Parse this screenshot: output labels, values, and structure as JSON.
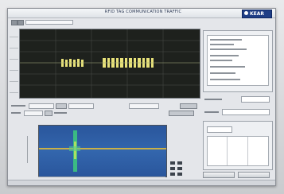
{
  "window": {
    "title": "RFID TAG COMMUNICATION TRAFFIC",
    "brand": "KEAR"
  },
  "toolbar": {
    "selector_value": ""
  },
  "colors": {
    "plot_background": "#1e211d",
    "signal_pulse": "#e8e27a",
    "spectrogram_background": "#2f5fa4",
    "spectrogram_signal": "#3fd27a",
    "spectrogram_line": "#c9b048"
  },
  "right_panel": {
    "top_group_title": "",
    "middle_group_title": "",
    "buttons": [
      "",
      "",
      "",
      ""
    ]
  }
}
